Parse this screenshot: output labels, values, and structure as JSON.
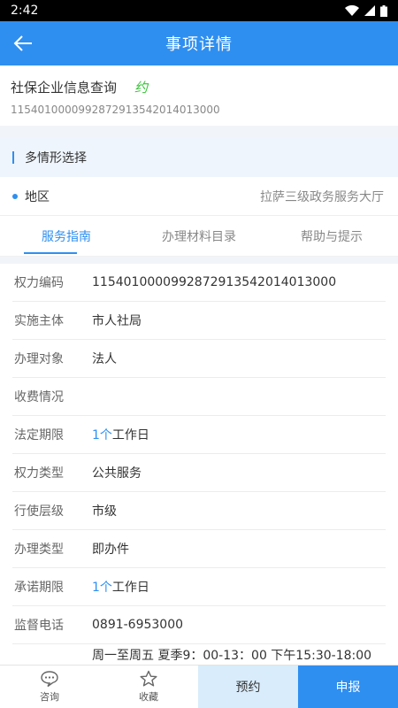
{
  "status_bar": {
    "time": "2:42"
  },
  "header": {
    "title": "事项详情"
  },
  "item": {
    "name": "社保企业信息查询",
    "appointment_tag": "约",
    "code": "11540100009928729135420140130​00"
  },
  "scenario": {
    "label": "多情形选择"
  },
  "region": {
    "label": "地区",
    "value": "拉萨三级政务服务大厅"
  },
  "tabs": [
    {
      "label": "服务指南"
    },
    {
      "label": "办理材料目录"
    },
    {
      "label": "帮助与提示"
    }
  ],
  "details": {
    "power_code": {
      "label": "权力编码",
      "value": "11540100009928729135420140130​00"
    },
    "subject": {
      "label": "实施主体",
      "value": "市人社局"
    },
    "target": {
      "label": "办理对象",
      "value": "法人"
    },
    "fee": {
      "label": "收费情况",
      "value": ""
    },
    "legal_limit": {
      "label": "法定期限",
      "num": "1个",
      "unit": "工作日"
    },
    "power_type": {
      "label": "权力类型",
      "value": "公共服务"
    },
    "level": {
      "label": "行使层级",
      "value": "市级"
    },
    "handle_type": {
      "label": "办理类型",
      "value": "即办件"
    },
    "promise_limit": {
      "label": "承诺期限",
      "num": "1个",
      "unit": "工作日"
    },
    "phone": {
      "label": "监督电话",
      "value": "0891-6953000"
    },
    "hours_partial": {
      "value": "周一至周五 夏季9：00-13：00 下午15:30-18:00"
    }
  },
  "bottom_bar": {
    "consult": "咨询",
    "favorite": "收藏",
    "appointment": "预约",
    "apply": "申报"
  },
  "colors": {
    "primary": "#2f8ff0",
    "tag_green": "#35c235",
    "light_blue": "#d9ecfb"
  }
}
